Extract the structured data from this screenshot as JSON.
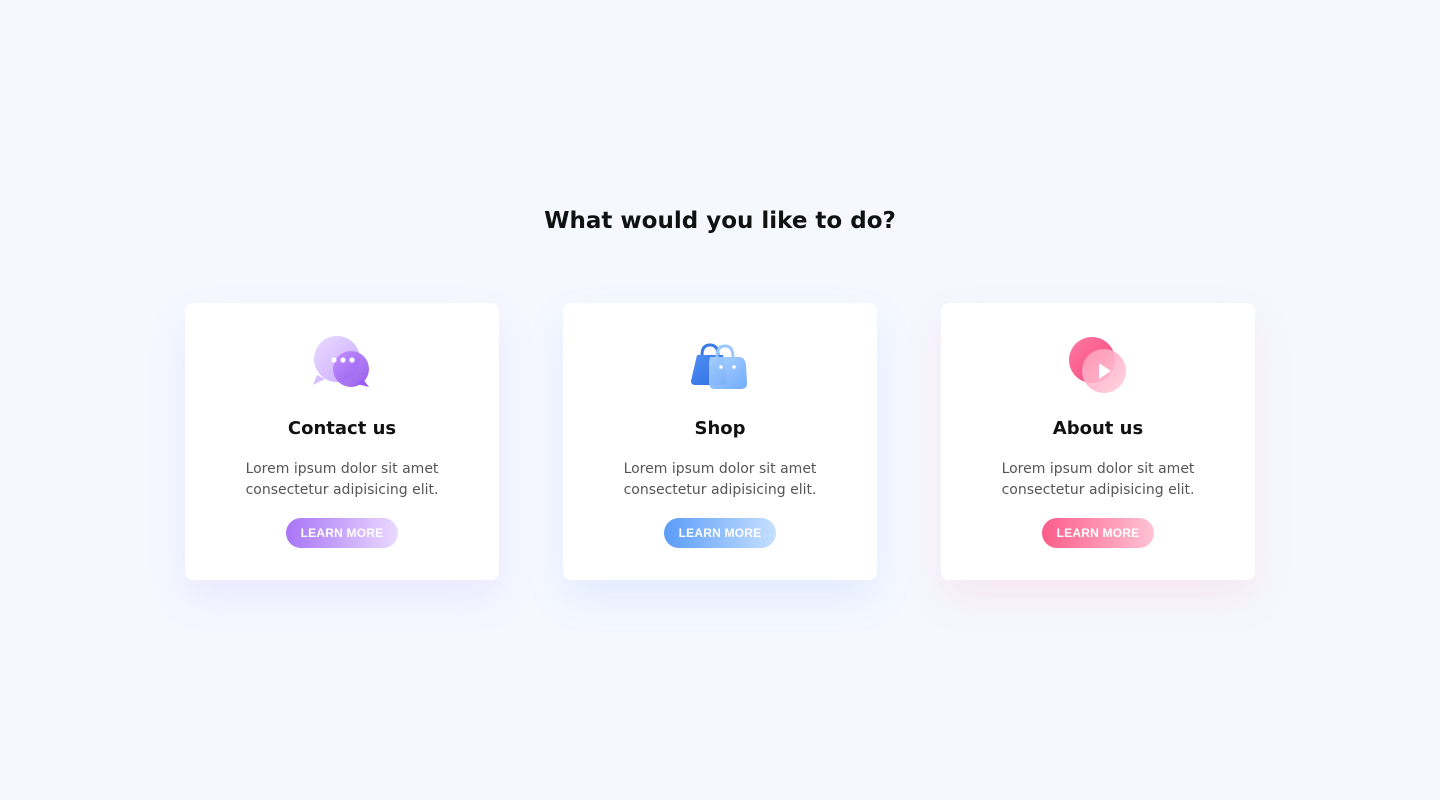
{
  "heading": "What would you like to do?",
  "cards": [
    {
      "title": "Contact us",
      "description_line1": "Lorem ipsum dolor sit amet",
      "description_line2": "consectetur adipisicing elit.",
      "button_label": "LEARN MORE",
      "icon": "chat-bubbles-icon",
      "accent": "#a875f5"
    },
    {
      "title": "Shop",
      "description_line1": "Lorem ipsum dolor sit amet",
      "description_line2": "consectetur adipisicing elit.",
      "button_label": "LEARN MORE",
      "icon": "shopping-bags-icon",
      "accent": "#5b9cf8"
    },
    {
      "title": "About us",
      "description_line1": "Lorem ipsum dolor sit amet",
      "description_line2": "consectetur adipisicing elit.",
      "button_label": "LEARN MORE",
      "icon": "play-circle-icon",
      "accent": "#fb5d8a"
    }
  ],
  "colors": {
    "background": "#f5f8ff",
    "card": "#ffffff",
    "heading_text": "#111111",
    "body_text": "#555555"
  }
}
